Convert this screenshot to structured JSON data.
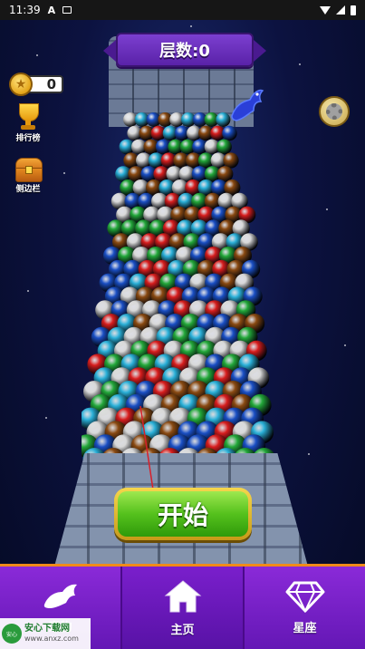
{
  "status_bar": {
    "time": "11:39"
  },
  "hud": {
    "level_label": "层数:0",
    "coins": "0",
    "leaderboard_label": "排行榜",
    "sidebar_label": "侧边栏"
  },
  "start_button": {
    "label": "开始"
  },
  "bottom_nav": [
    {
      "label": "宠物",
      "icon": "dragon-icon"
    },
    {
      "label": "主页",
      "icon": "home-icon"
    },
    {
      "label": "星座",
      "icon": "diamond-icon"
    }
  ],
  "watermark": {
    "title": "安心下载网",
    "url": "www.anxz.com"
  },
  "colors": {
    "nav_purple": "#7a22cc",
    "nav_border": "#f08a1a",
    "banner_purple": "#6a2ec0",
    "start_green": "#55c11d",
    "start_gold": "#e4b52a",
    "ball_colors": [
      "#1a4fc4",
      "#8a4a12",
      "#d8d8d8",
      "#2ab0d8",
      "#d81e1e",
      "#23a83a"
    ]
  }
}
